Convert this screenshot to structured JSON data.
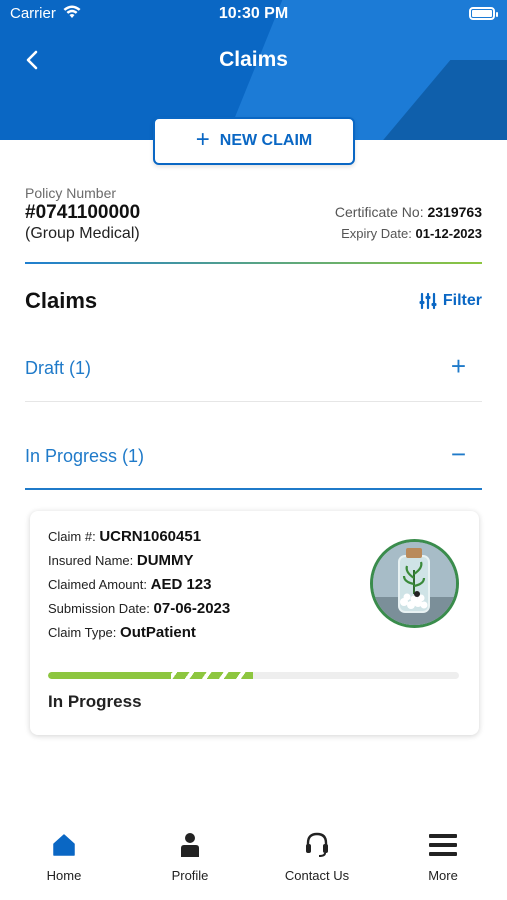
{
  "status_bar": {
    "carrier": "Carrier",
    "time": "10:30 PM"
  },
  "header": {
    "title": "Claims"
  },
  "new_claim": {
    "label": "NEW CLAIM"
  },
  "policy": {
    "label": "Policy Number",
    "number": "#0741100000",
    "type": "(Group Medical)",
    "certificate_label": "Certificate No:",
    "certificate_value": "2319763",
    "expiry_label": "Expiry Date:",
    "expiry_value": "01-12-2023"
  },
  "claims_section": {
    "heading": "Claims",
    "filter_label": "Filter",
    "groups": [
      {
        "label": "Draft (1)",
        "toggle": "+"
      },
      {
        "label": "In Progress (1)",
        "toggle": "−"
      }
    ]
  },
  "claim_card": {
    "claim_no_label": "Claim #:",
    "claim_no": "UCRN1060451",
    "insured_label": "Insured Name:",
    "insured": "DUMMY",
    "amount_label": "Claimed Amount:",
    "amount": "AED 123",
    "submission_label": "Submission Date:",
    "submission_date": "07-06-2023",
    "type_label": "Claim Type:",
    "type": "OutPatient",
    "progress_fraction": 0.5,
    "status": "In Progress"
  },
  "bottom_nav": [
    {
      "label": "Home",
      "icon": "home-icon",
      "active": true
    },
    {
      "label": "Profile",
      "icon": "profile-icon"
    },
    {
      "label": "Contact Us",
      "icon": "headset-icon"
    },
    {
      "label": "More",
      "icon": "menu-icon"
    }
  ],
  "colors": {
    "brand_blue": "#0a67c4",
    "accent_green": "#8dc63f",
    "link_blue": "#1f7ac9"
  }
}
